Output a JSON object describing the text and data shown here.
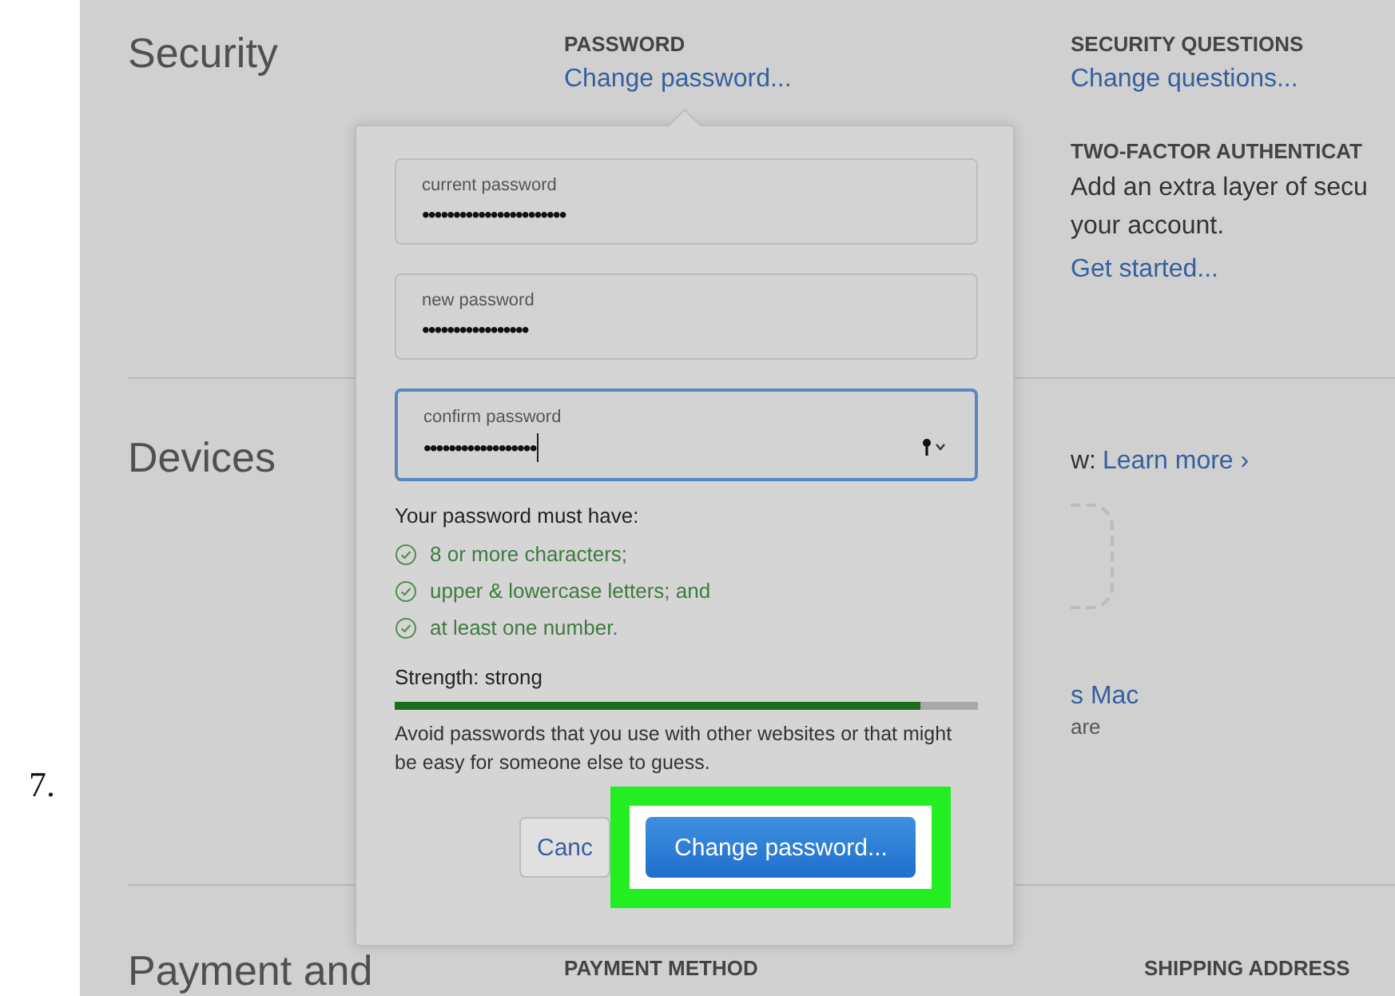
{
  "step_number": "7.",
  "sections": [
    {
      "title": "Security",
      "columns": [
        {
          "heading": "PASSWORD",
          "link": "Change password..."
        },
        {
          "heading": "SECURITY QUESTIONS",
          "link": "Change questions...",
          "heading_2": "TWO-FACTOR AUTHENTICAT",
          "text": "Add an extra layer of secu your account.",
          "link_2": "Get started..."
        }
      ]
    },
    {
      "title": "Devices",
      "columns": [
        {
          "text": "w:",
          "link": "Learn more ›",
          "device_name": "s Mac",
          "device_text": "are"
        }
      ]
    },
    {
      "title": "Payment and",
      "columns": [
        {
          "heading": "PAYMENT METHOD"
        },
        {
          "heading": "SHIPPING ADDRESS"
        }
      ]
    }
  ],
  "popover": {
    "fields": [
      {
        "placeholder": "current password",
        "value": "•••••••••••••••••••••••",
        "focused": false,
        "key_icon": false
      },
      {
        "placeholder": "new password",
        "value": "•••••••••••••••••",
        "focused": false,
        "key_icon": false
      },
      {
        "placeholder": "confirm password",
        "value": "••••••••••••••••••",
        "focused": true,
        "key_icon": true
      }
    ],
    "requirements_title": "Your password must have:",
    "requirements": [
      {
        "text": "8 or more characters;",
        "met": true
      },
      {
        "text": "upper & lowercase letters; and",
        "met": true
      },
      {
        "text": "at least one number.",
        "met": true
      }
    ],
    "strength_label": "Strength: strong",
    "strength": {
      "level": 0.9
    },
    "advice": "Avoid passwords that you use with other websites or that might be easy for someone else to guess.",
    "buttons": [
      {
        "label": "Canc",
        "kind": "secondary"
      },
      {
        "label": "Change password...",
        "kind": "primary",
        "highlighted": true
      }
    ]
  }
}
